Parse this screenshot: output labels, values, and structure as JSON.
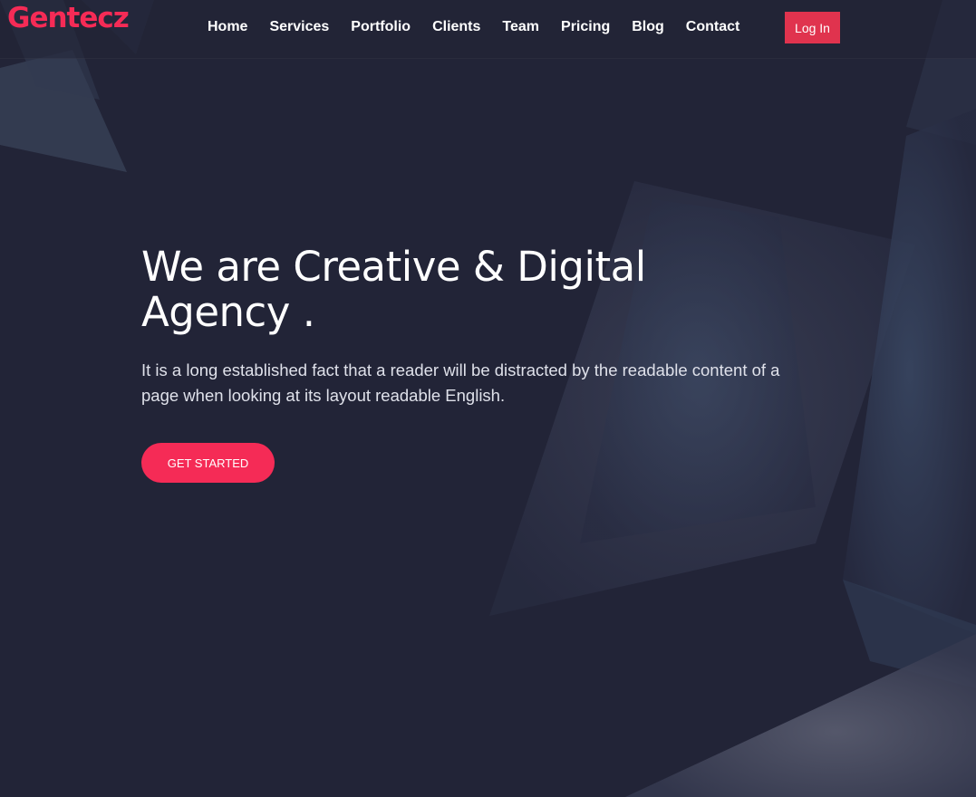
{
  "brand": {
    "name": "Gentecz",
    "accent": "#f52b56"
  },
  "nav": {
    "items": [
      {
        "label": "Home"
      },
      {
        "label": "Services"
      },
      {
        "label": "Portfolio"
      },
      {
        "label": "Clients"
      },
      {
        "label": "Team"
      },
      {
        "label": "Pricing"
      },
      {
        "label": "Blog"
      },
      {
        "label": "Contact"
      }
    ],
    "login_label": "Log In"
  },
  "hero": {
    "title": "We are Creative & Digital Agency .",
    "description": "It is a long established fact that a reader will be distracted by the readable content of a page when looking at its layout readable English.",
    "cta_label": "GET STARTED"
  },
  "colors": {
    "background": "#222437",
    "login_button": "#e0334e",
    "cta_button": "#f52b56"
  }
}
